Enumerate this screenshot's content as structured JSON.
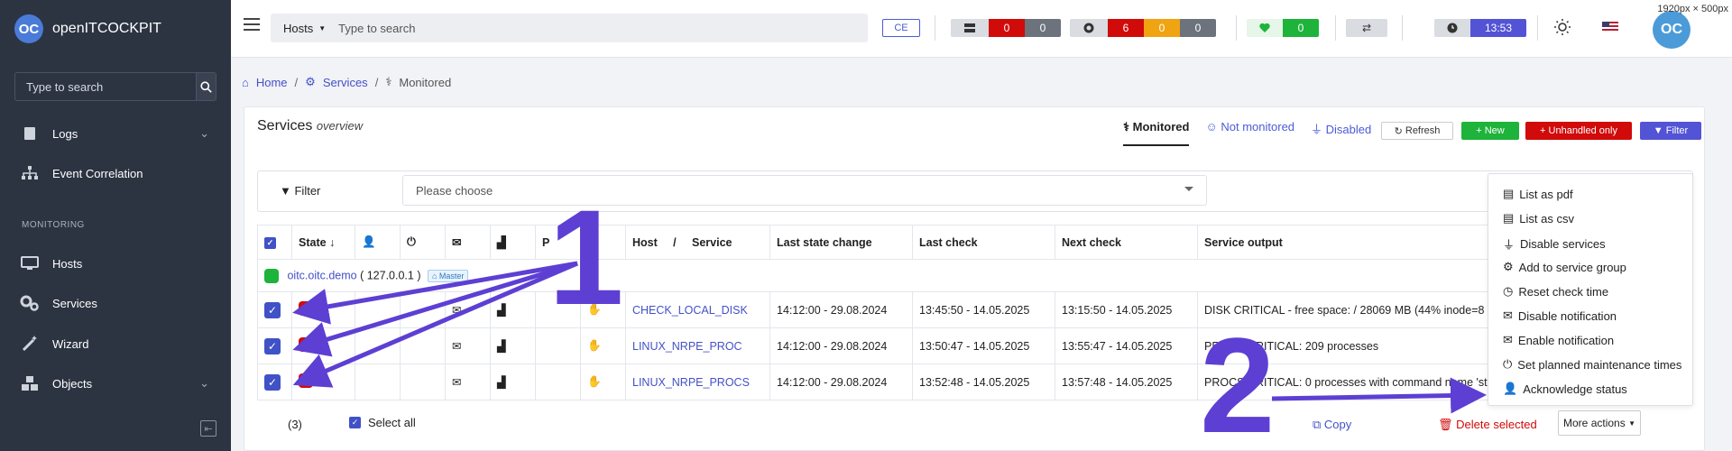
{
  "app": {
    "name": "openITCOCKPIT",
    "logo_text": "OC"
  },
  "sidebar": {
    "search_placeholder": "Type to search",
    "items": [
      {
        "label": "Logs",
        "icon": "file-icon",
        "chevron": true
      },
      {
        "label": "Event Correlation",
        "icon": "sitemap-icon",
        "chevron": false
      },
      {
        "label": "Hosts",
        "icon": "desktop-icon",
        "chevron": false
      },
      {
        "label": "Services",
        "icon": "cogs-icon",
        "chevron": false
      },
      {
        "label": "Wizard",
        "icon": "magic-wand-icon",
        "chevron": false
      },
      {
        "label": "Objects",
        "icon": "cubes-icon",
        "chevron": true
      }
    ],
    "section_label": "MONITORING"
  },
  "topbar": {
    "search_type": "Hosts",
    "search_placeholder": "Type to search",
    "edition_badge": "CE",
    "host_counts": [
      "0",
      "0"
    ],
    "service_counts": [
      "6",
      "0",
      "0"
    ],
    "health_count": "0",
    "time": "13:53",
    "size_label": "1920px × 500px"
  },
  "breadcrumb": {
    "home": "Home",
    "services": "Services",
    "current": "Monitored"
  },
  "card": {
    "title": "Services",
    "subtitle": "overview",
    "tabs": {
      "monitored": "Monitored",
      "not_monitored": "Not monitored",
      "disabled": "Disabled"
    },
    "buttons": {
      "refresh": "Refresh",
      "new": "New",
      "unhandled": "Unhandled only",
      "filter": "Filter"
    }
  },
  "filter": {
    "label": "Filter",
    "placeholder": "Please choose"
  },
  "table": {
    "headers": {
      "state": "State",
      "p": "P",
      "host": "Host",
      "slash": "/",
      "service": "Service",
      "last_state_change": "Last state change",
      "last_check": "Last check",
      "next_check": "Next check",
      "output": "Service output"
    },
    "host": {
      "name": "oitc.oitc.demo",
      "ip": "( 127.0.0.1 )",
      "badge": "Master"
    },
    "rows": [
      {
        "service": "CHECK_LOCAL_DISK",
        "last_state_change": "14:12:00 - 29.08.2024",
        "last_check": "13:45:50 - 14.05.2025",
        "next_check": "13:15:50 - 14.05.2025",
        "output": "DISK CRITICAL - free space: / 28069 MB (44% inode=8"
      },
      {
        "service": "LINUX_NRPE_PROC",
        "last_state_change": "14:12:00 - 29.08.2024",
        "last_check": "13:50:47 - 14.05.2025",
        "next_check": "13:55:47 - 14.05.2025",
        "output": "PROCS CRITICAL: 209 processes"
      },
      {
        "service": "LINUX_NRPE_PROCS",
        "last_state_change": "14:12:00 - 29.08.2024",
        "last_check": "13:52:48 - 14.05.2025",
        "next_check": "13:57:48 - 14.05.2025",
        "output": "PROCS CRITICAL: 0 processes with command name 'st"
      }
    ]
  },
  "footer": {
    "count": "(3)",
    "select_all": "Select all",
    "copy": "Copy",
    "delete": "Delete selected",
    "more": "More actions"
  },
  "dropdown": {
    "items": [
      {
        "label": "List as pdf",
        "icon": "pdf-file-icon"
      },
      {
        "label": "List as csv",
        "icon": "csv-file-icon"
      },
      {
        "label": "Disable services",
        "icon": "plug-icon"
      },
      {
        "label": "Add to service group",
        "icon": "cogs-icon"
      },
      {
        "label": "Reset check time",
        "icon": "clock-icon"
      },
      {
        "label": "Disable notification",
        "icon": "envelope-icon"
      },
      {
        "label": "Enable notification",
        "icon": "envelope-icon"
      },
      {
        "label": "Set planned maintenance times",
        "icon": "power-icon"
      },
      {
        "label": "Acknowledge status",
        "icon": "user-icon"
      }
    ]
  },
  "annotations": {
    "num1": "1",
    "num2": "2"
  },
  "colors": {
    "accent": "#5353d6",
    "critical": "#d10a0a",
    "ok": "#1eb33a",
    "sidebar": "#2c3442"
  }
}
